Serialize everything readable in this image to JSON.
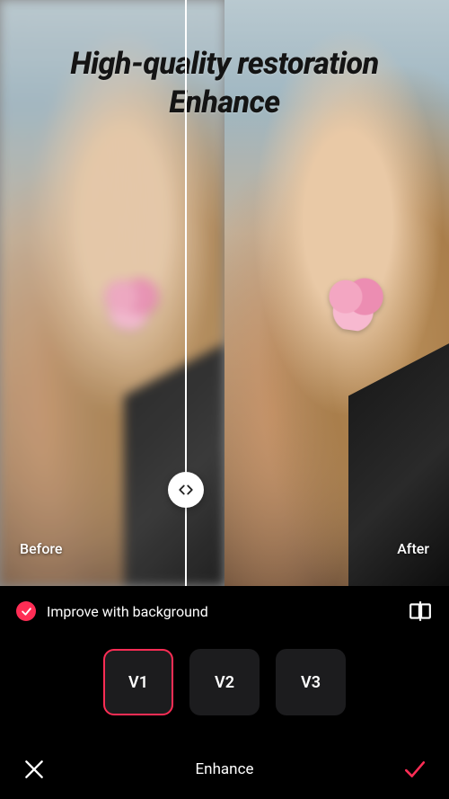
{
  "heading": {
    "line1": "High-quality restoration",
    "line2": "Enhance"
  },
  "preview": {
    "before_label": "Before",
    "after_label": "After",
    "slider_glyph": "‹ ›"
  },
  "option": {
    "label": "Improve with background",
    "checked": true
  },
  "versions": [
    {
      "label": "V1",
      "selected": true
    },
    {
      "label": "V2",
      "selected": false
    },
    {
      "label": "V3",
      "selected": false
    }
  ],
  "bottom": {
    "title": "Enhance"
  },
  "colors": {
    "accent": "#ff2d55"
  }
}
